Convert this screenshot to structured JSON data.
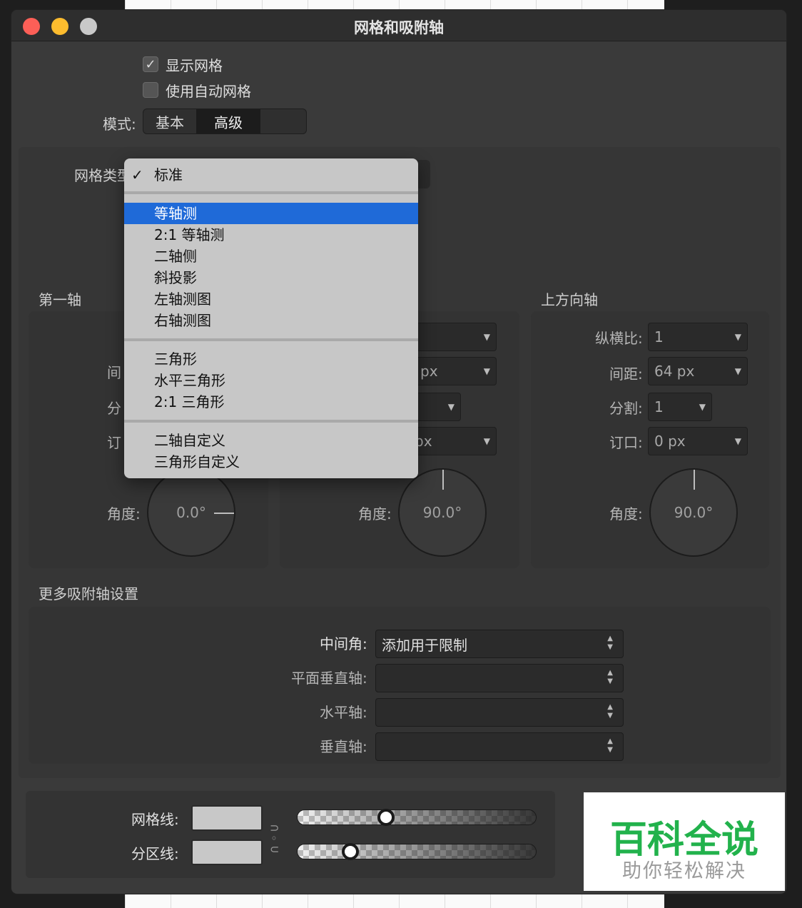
{
  "window": {
    "title": "网格和吸附轴"
  },
  "options": {
    "show_grid": "显示网格",
    "auto_grid": "使用自动网格",
    "checkmark": "✓"
  },
  "mode": {
    "label": "模式:",
    "basic": "基本",
    "advanced": "高级"
  },
  "grid_type": {
    "label": "网格类型"
  },
  "menu": {
    "check": "✓",
    "items": [
      "标准",
      "等轴测",
      "2:1 等轴测",
      "二轴侧",
      "斜投影",
      "左轴测图",
      "右轴测图",
      "三角形",
      "水平三角形",
      "2:1 三角形",
      "二轴自定义",
      "三角形自定义"
    ]
  },
  "first_axis": {
    "title": "第一轴",
    "spacing_label_visible": "间",
    "divide_label_visible": "分",
    "notch_label_visible": "订",
    "angle_label": "角度:",
    "angle": "0.0°"
  },
  "second_axis": {
    "spacing_partial": "px",
    "notch_partial": "px",
    "angle_label": "角度:",
    "angle": "90.0°"
  },
  "up_axis": {
    "title": "上方向轴",
    "aspect_label": "纵横比:",
    "aspect_value": "1",
    "spacing_label": "间距:",
    "spacing_value": "64 px",
    "divide_label": "分割:",
    "divide_value": "1",
    "notch_label": "订口:",
    "notch_value": "0 px",
    "angle_label": "角度:",
    "angle": "90.0°"
  },
  "more": {
    "title": "更多吸附轴设置",
    "mid_angle_label": "中间角:",
    "mid_angle_value": "添加用于限制",
    "plane_vertical_label": "平面垂直轴:",
    "horizontal_label": "水平轴:",
    "vertical_label": "垂直轴:"
  },
  "lines": {
    "grid_line_label": "网格线:",
    "division_line_label": "分区线:",
    "grid_line_opacity": 0.36,
    "division_line_opacity": 0.2
  },
  "watermark": {
    "big": "百科全说",
    "small": "助你轻松解决"
  },
  "colors": {
    "traffic_red": "#fc5f57",
    "traffic_yellow": "#fdbc2e",
    "highlight": "#1f6ad8",
    "watermark_green": "#22b24c"
  }
}
